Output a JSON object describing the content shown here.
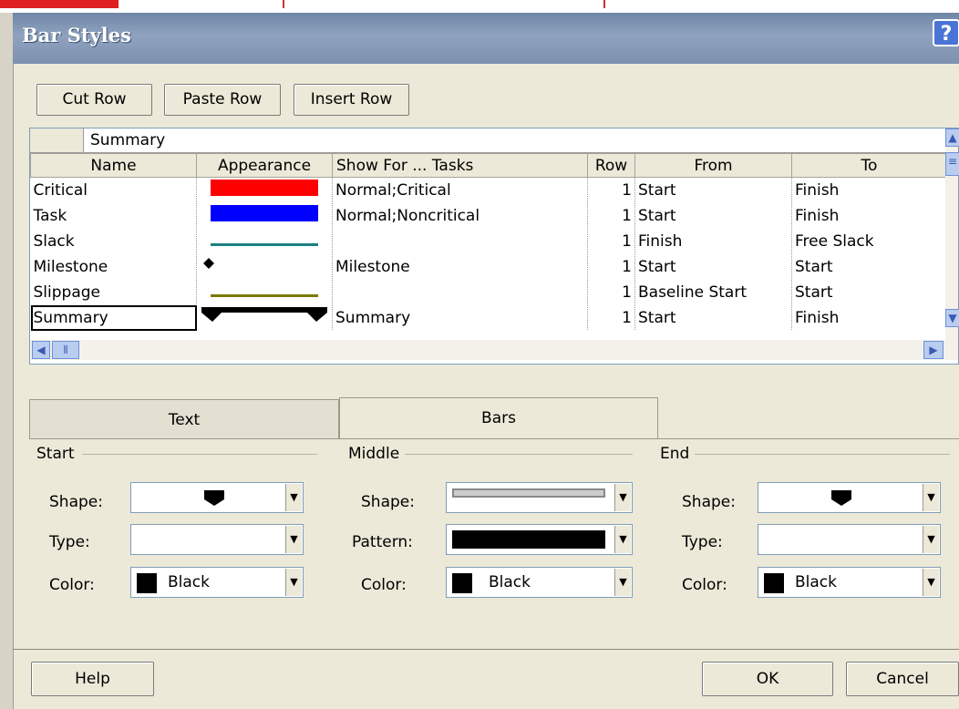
{
  "window": {
    "title": "Bar Styles",
    "help_glyph": "?"
  },
  "toolbar": {
    "cut_label": "Cut Row",
    "paste_label": "Paste Row",
    "insert_label": "Insert Row"
  },
  "grid": {
    "edit_value": "Summary",
    "columns": [
      "Name",
      "Appearance",
      "Show For ... Tasks",
      "Row",
      "From",
      "To"
    ],
    "rows": [
      {
        "name": "Critical",
        "appearance": "red-bar",
        "show_for": "Normal;Critical",
        "row": "1",
        "from": "Start",
        "to": "Finish"
      },
      {
        "name": "Task",
        "appearance": "blue-bar",
        "show_for": "Normal;Noncritical",
        "row": "1",
        "from": "Start",
        "to": "Finish"
      },
      {
        "name": "Slack",
        "appearance": "teal-line",
        "show_for": "",
        "row": "1",
        "from": "Finish",
        "to": "Free Slack"
      },
      {
        "name": "Milestone",
        "appearance": "diamond",
        "show_for": "Milestone",
        "row": "1",
        "from": "Start",
        "to": "Start"
      },
      {
        "name": "Slippage",
        "appearance": "olive-line",
        "show_for": "",
        "row": "1",
        "from": "Baseline Start",
        "to": "Start"
      },
      {
        "name": "Summary",
        "appearance": "summary-bar",
        "show_for": "Summary",
        "row": "1",
        "from": "Start",
        "to": "Finish"
      }
    ],
    "selected_row": "Summary"
  },
  "tabs": {
    "text_label": "Text",
    "bars_label": "Bars",
    "active": "Bars"
  },
  "start": {
    "title": "Start",
    "shape_label": "Shape:",
    "type_label": "Type:",
    "color_label": "Color:",
    "color_value": "Black"
  },
  "middle": {
    "title": "Middle",
    "shape_label": "Shape:",
    "pattern_label": "Pattern:",
    "color_label": "Color:",
    "color_value": "Black"
  },
  "end": {
    "title": "End",
    "shape_label": "Shape:",
    "type_label": "Type:",
    "color_label": "Color:",
    "color_value": "Black"
  },
  "footer": {
    "help_label": "Help",
    "ok_label": "OK",
    "cancel_label": "Cancel"
  },
  "colors": {
    "critical": "#ff0000",
    "task": "#0000ff",
    "slack": "#1a8080",
    "slippage": "#7a7a00",
    "titlebar": "#7d91b0"
  }
}
